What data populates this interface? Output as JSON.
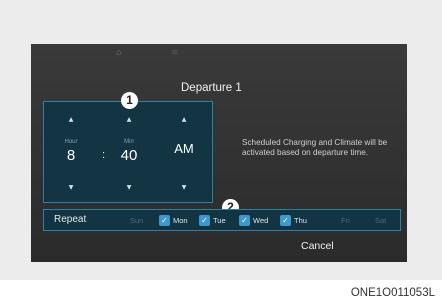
{
  "dialog": {
    "title": "Departure 1",
    "hour": {
      "label": "Hour",
      "value": "8"
    },
    "minute": {
      "label": "Min",
      "value": "40"
    },
    "ampm": "AM",
    "separator": ":",
    "info_text": "Scheduled Charging and Climate will be activated based on departure time.",
    "repeat_label": "Repeat",
    "days": [
      {
        "label": "Sun",
        "checked": false
      },
      {
        "label": "Mon",
        "checked": true
      },
      {
        "label": "Tue",
        "checked": true
      },
      {
        "label": "Wed",
        "checked": true
      },
      {
        "label": "Thu",
        "checked": true
      },
      {
        "label": "Fri",
        "checked": false
      },
      {
        "label": "Sat",
        "checked": false
      }
    ],
    "cancel_label": "Cancel"
  },
  "callouts": {
    "one": "1",
    "two": "2"
  },
  "glyphs": {
    "up": "▲",
    "down": "▼",
    "check": "✓"
  },
  "caption": "ONE1O011053L",
  "colors": {
    "panel": "#123443",
    "border": "#2f7fa3",
    "checkbox": "#3e98d0"
  }
}
